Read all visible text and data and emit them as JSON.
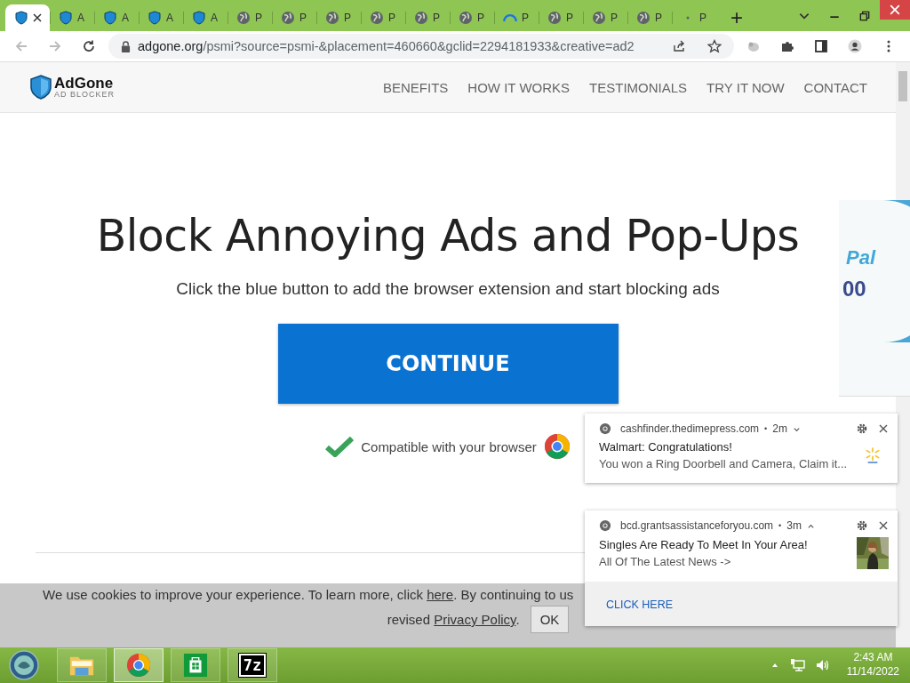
{
  "browser": {
    "tabs": [
      {
        "kind": "shield",
        "selected": true
      },
      {
        "kind": "shield",
        "label": "A",
        "selected": false
      },
      {
        "kind": "shield",
        "label": "A",
        "selected": false
      },
      {
        "kind": "shield",
        "label": "A",
        "selected": false
      },
      {
        "kind": "shield",
        "label": "A",
        "selected": false
      },
      {
        "kind": "globe",
        "label": "P",
        "selected": false
      },
      {
        "kind": "globe",
        "label": "P",
        "selected": false
      },
      {
        "kind": "globe",
        "label": "P",
        "selected": false
      },
      {
        "kind": "globe",
        "label": "P",
        "selected": false
      },
      {
        "kind": "globe",
        "label": "P",
        "selected": false
      },
      {
        "kind": "globe",
        "label": "P",
        "selected": false
      },
      {
        "kind": "spinner",
        "label": "P",
        "selected": false
      },
      {
        "kind": "globe",
        "label": "P",
        "selected": false
      },
      {
        "kind": "globe",
        "label": "P",
        "selected": false
      },
      {
        "kind": "globe",
        "label": "P",
        "selected": false
      },
      {
        "kind": "dot",
        "label": "P",
        "selected": false
      }
    ],
    "new_tab": "+",
    "address": {
      "domain": "adgone.org",
      "path": "/psmi?source=psmi-&placement=460660&gclid=2294181933&creative=ad2"
    }
  },
  "site": {
    "logo": {
      "name": "AdGone",
      "tagline": "AD BLOCKER"
    },
    "nav": [
      "BENEFITS",
      "HOW IT WORKS",
      "TESTIMONIALS",
      "TRY IT NOW",
      "CONTACT"
    ],
    "headline": "Block Annoying Ads and Pop-Ups",
    "subhead": "Click the blue button to add the browser extension and start blocking ads",
    "cta": "CONTINUE",
    "compat": "Compatible with your browser"
  },
  "ad_fragment": {
    "line_1": "Pal",
    "line_2": "00"
  },
  "cookie_banner": {
    "line_1_before": "We use cookies to improve your experience. To learn more, click ",
    "line_1_link": "here",
    "line_1_after": ". By continuing to us",
    "line_2_before": "revised ",
    "line_2_link": "Privacy Policy",
    "line_2_after": ".",
    "button": "OK"
  },
  "notifications": [
    {
      "kind": "spark",
      "source": "cashfinder.thedimepress.com",
      "separator": "•",
      "time": "2m",
      "expanded": false,
      "title": "Walmart: Congratulations!",
      "body": "You won a Ring Doorbell and Camera, Claim it..."
    },
    {
      "source": "bcd.grantsassistanceforyou.com",
      "separator": "•",
      "time": "3m",
      "expanded": true,
      "title": "Singles Are Ready To Meet In Your Area!",
      "body": "All Of The Latest News ->",
      "action": "CLICK HERE"
    }
  ],
  "taskbar": {
    "apps": [
      {
        "kind": "folder",
        "selected": false
      },
      {
        "kind": "chrome",
        "selected": true
      },
      {
        "kind": "store",
        "selected": false
      },
      {
        "kind": "sevenzip",
        "label": "7z",
        "selected": false
      }
    ],
    "time": "2:43 AM",
    "date": "11/14/2022"
  }
}
